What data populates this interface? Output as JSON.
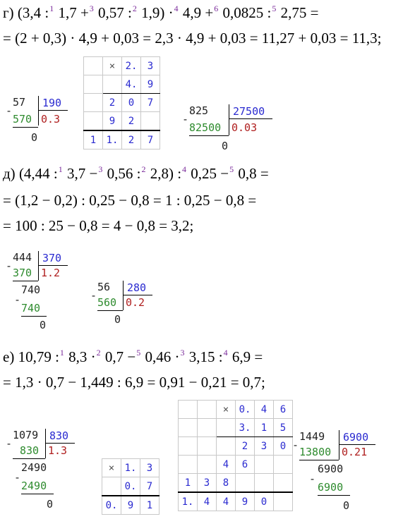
{
  "g": {
    "label": "г)",
    "line1": [
      "(3,4 :",
      "1",
      " 1,7 +",
      "3",
      " 0,57 :",
      "2",
      " 1,9) ·",
      "4",
      " 4,9 +",
      "6",
      " 0,0825 :",
      "5",
      " 2,75 ="
    ],
    "line2": "= (2 + 0,3) · 4,9 + 0,03 = 2,3 · 4,9 + 0,03 = 11,27 + 0,03 = 11,3;",
    "div1": {
      "dividend": "57",
      "divisor": "190",
      "sub": "570",
      "quot": "0.3",
      "rem": "0"
    },
    "mult": {
      "sign": "×",
      "r1": [
        "2.",
        "3"
      ],
      "r2": [
        "4.",
        "9"
      ],
      "p1": [
        "2",
        "0",
        "7"
      ],
      "p2": [
        "9",
        "2"
      ],
      "res": [
        "1",
        "1.",
        "2",
        "7"
      ]
    },
    "div2": {
      "dividend": "825",
      "divisor": "27500",
      "sub": "82500",
      "quot": "0.03",
      "rem": "0"
    }
  },
  "d": {
    "label": "д)",
    "line1": [
      "(4,44 :",
      "1",
      " 3,7 −",
      "3",
      " 0,56 :",
      "2",
      " 2,8) :",
      "4",
      " 0,25 −",
      "5",
      " 0,8 ="
    ],
    "line2": "= (1,2 − 0,2) : 0,25 − 0,8 = 1 : 0,25 − 0,8 =",
    "line3": "= 100 : 25 − 0,8 = 4 − 0,8 = 3,2;",
    "div1": {
      "dividend": "444",
      "divisor": "370",
      "sub": "370",
      "quot": "1.2",
      "r1": "740",
      "sub2": "740",
      "rem": "0"
    },
    "div2": {
      "dividend": "56",
      "divisor": "280",
      "sub": "560",
      "quot": "0.2",
      "rem": "0"
    }
  },
  "e": {
    "label": "е)",
    "line1": [
      "10,79 :",
      "1",
      " 8,3 ·",
      "2",
      " 0,7 −",
      "5",
      " 0,46 ·",
      "3",
      " 3,15 :",
      "4",
      " 6,9 ="
    ],
    "line2": "= 1,3 · 0,7 − 1,449 : 6,9 = 0,91 − 0,21 = 0,7;",
    "div1": {
      "dividend": "1079",
      "divisor": "830",
      "sub": "830",
      "quot": "1.3",
      "r1": "2490",
      "sub2": "2490",
      "rem": "0"
    },
    "mult1": {
      "sign": "×",
      "r1": [
        "1.",
        "3"
      ],
      "r2": [
        "0.",
        "7"
      ],
      "res": [
        "0.",
        "9",
        "1"
      ]
    },
    "mult2": {
      "sign": "×",
      "r1": [
        "0.",
        "4",
        "6"
      ],
      "r2": [
        "3.",
        "1",
        "5"
      ],
      "p1": [
        "2",
        "3",
        "0"
      ],
      "p2": [
        "4",
        "6"
      ],
      "p3": [
        "1",
        "3",
        "8"
      ],
      "res": [
        "1.",
        "4",
        "4",
        "9",
        "0"
      ]
    },
    "div2": {
      "dividend": "1449",
      "divisor": "6900",
      "sub": "13800",
      "quot": "0.21",
      "r1": "6900",
      "sub2": "6900",
      "rem": "0"
    }
  }
}
